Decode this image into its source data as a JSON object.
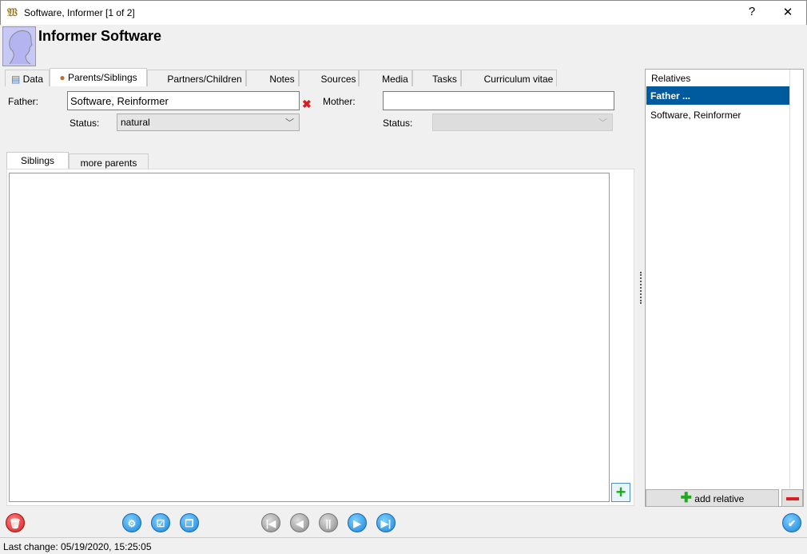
{
  "window": {
    "title": "Software, Informer [1 of 2]",
    "help": "?",
    "close": "✕"
  },
  "header": {
    "name": "Informer Software"
  },
  "tabs": [
    {
      "label": "Data"
    },
    {
      "label": "Parents/Siblings"
    },
    {
      "label": "Partners/Children"
    },
    {
      "label": "Notes"
    },
    {
      "label": "Sources"
    },
    {
      "label": "Media"
    },
    {
      "label": "Tasks"
    },
    {
      "label": "Curriculum vitae"
    }
  ],
  "parents": {
    "father_label": "Father:",
    "father_value": "Software, Reinformer",
    "mother_label": "Mother:",
    "mother_value": "",
    "status_label": "Status:",
    "father_status": "natural",
    "mother_status": ""
  },
  "subtabs": [
    {
      "label": "Siblings"
    },
    {
      "label": "more parents"
    }
  ],
  "relatives": {
    "header": "Relatives",
    "items": [
      {
        "label": "Father ...",
        "selected": true
      },
      {
        "label": "Software, Reinformer",
        "selected": false
      }
    ],
    "add_label": "add relative"
  },
  "status": {
    "last_change": "Last change: 05/19/2020, 15:25:05"
  },
  "colors": {
    "selection": "#005a9e",
    "accent_blue": "#1b84d8",
    "delete_red": "#d62020",
    "add_green": "#22a822"
  }
}
